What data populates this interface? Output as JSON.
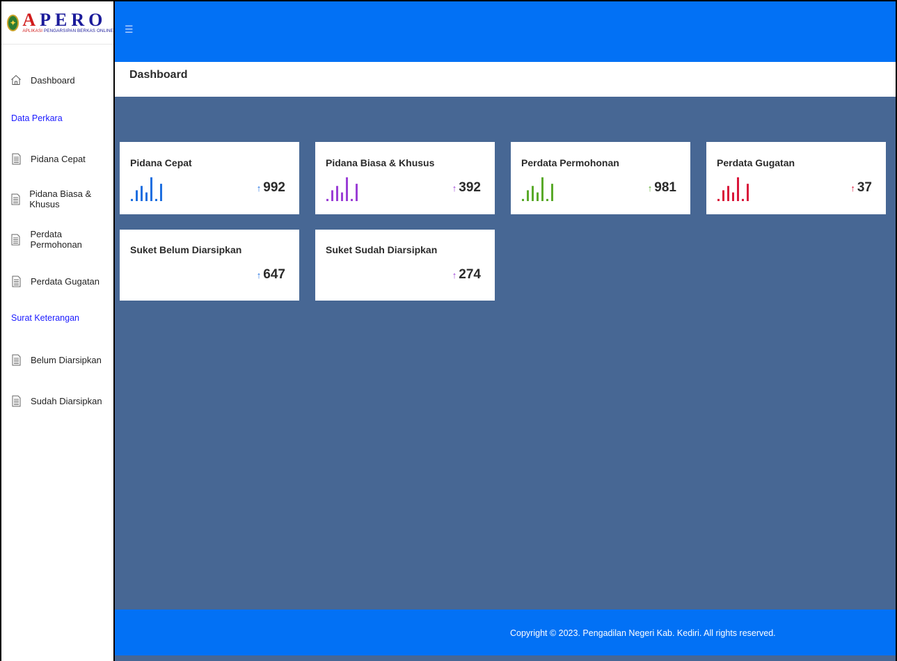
{
  "brand": {
    "title_a": "A",
    "title_rest": "PERO",
    "subtitle_a": "APLIKASI",
    "subtitle_rest": " PENGARSIPAN BERKAS ONLINE",
    "emblem_icon": "court-emblem-icon",
    "colors": {
      "navy": "#1b1b9a",
      "red": "#d11c1c"
    }
  },
  "topbar": {
    "menu_icon": "hamburger-icon",
    "color": "#0271f5"
  },
  "sidebar": {
    "dashboard": {
      "label": "Dashboard",
      "icon": "home-icon"
    },
    "section1": "Data Perkara",
    "items1": [
      {
        "label": "Pidana Cepat",
        "icon": "document-icon"
      },
      {
        "label": "Pidana Biasa & Khusus",
        "icon": "document-icon"
      },
      {
        "label": "Perdata Permohonan",
        "icon": "document-icon"
      },
      {
        "label": "Perdata Gugatan",
        "icon": "document-icon"
      }
    ],
    "section2": "Surat Keterangan",
    "items2": [
      {
        "label": "Belum Diarsipkan",
        "icon": "document-icon"
      },
      {
        "label": "Sudah Diarsipkan",
        "icon": "document-icon"
      }
    ]
  },
  "page": {
    "title": "Dashboard"
  },
  "cards": [
    {
      "title": "Pidana Cepat",
      "value": "992",
      "arrow": "↑",
      "color": "#1e6fe0"
    },
    {
      "title": "Pidana Biasa & Khusus",
      "value": "392",
      "arrow": "↑",
      "color": "#9b3fd6"
    },
    {
      "title": "Perdata Permohonan",
      "value": "981",
      "arrow": "↑",
      "color": "#5aaa2a"
    },
    {
      "title": "Perdata Gugatan",
      "value": "37",
      "arrow": "↑",
      "color": "#d9163a"
    },
    {
      "title": "Suket Belum Diarsipkan",
      "value": "647",
      "arrow": "↑",
      "color": "#1e6fe0"
    },
    {
      "title": "Suket Sudah Diarsipkan",
      "value": "274",
      "arrow": "↑",
      "color": "#9b3fd6"
    }
  ],
  "sparkline": [
    1,
    5,
    7,
    4,
    11,
    1,
    8
  ],
  "footer": {
    "copyright": "Copyright © 2023. Pengadilan Negeri Kab. Kediri. All rights reserved."
  }
}
